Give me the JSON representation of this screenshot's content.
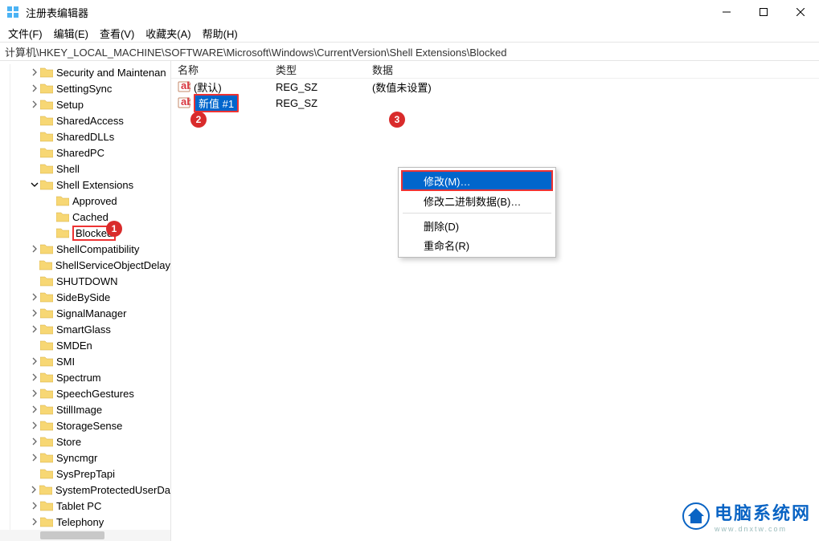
{
  "window": {
    "title": "注册表编辑器"
  },
  "menu": {
    "file": "文件(F)",
    "edit": "编辑(E)",
    "view": "查看(V)",
    "favorites": "收藏夹(A)",
    "help": "帮助(H)"
  },
  "address": "计算机\\HKEY_LOCAL_MACHINE\\SOFTWARE\\Microsoft\\Windows\\CurrentVersion\\Shell Extensions\\Blocked",
  "tree": {
    "items": [
      {
        "label": "Security and Maintenan",
        "level": 2,
        "expander": "right"
      },
      {
        "label": "SettingSync",
        "level": 2,
        "expander": "right"
      },
      {
        "label": "Setup",
        "level": 2,
        "expander": "right"
      },
      {
        "label": "SharedAccess",
        "level": 2,
        "expander": "none"
      },
      {
        "label": "SharedDLLs",
        "level": 2,
        "expander": "none"
      },
      {
        "label": "SharedPC",
        "level": 2,
        "expander": "none"
      },
      {
        "label": "Shell",
        "level": 2,
        "expander": "none"
      },
      {
        "label": "Shell Extensions",
        "level": 2,
        "expander": "down"
      },
      {
        "label": "Approved",
        "level": 3,
        "expander": "none"
      },
      {
        "label": "Cached",
        "level": 3,
        "expander": "none"
      },
      {
        "label": "Blocked",
        "level": 3,
        "expander": "none",
        "highlighted": true
      },
      {
        "label": "ShellCompatibility",
        "level": 2,
        "expander": "right"
      },
      {
        "label": "ShellServiceObjectDelay",
        "level": 2,
        "expander": "none"
      },
      {
        "label": "SHUTDOWN",
        "level": 2,
        "expander": "none"
      },
      {
        "label": "SideBySide",
        "level": 2,
        "expander": "right"
      },
      {
        "label": "SignalManager",
        "level": 2,
        "expander": "right"
      },
      {
        "label": "SmartGlass",
        "level": 2,
        "expander": "right"
      },
      {
        "label": "SMDEn",
        "level": 2,
        "expander": "none"
      },
      {
        "label": "SMI",
        "level": 2,
        "expander": "right"
      },
      {
        "label": "Spectrum",
        "level": 2,
        "expander": "right"
      },
      {
        "label": "SpeechGestures",
        "level": 2,
        "expander": "right"
      },
      {
        "label": "StillImage",
        "level": 2,
        "expander": "right"
      },
      {
        "label": "StorageSense",
        "level": 2,
        "expander": "right"
      },
      {
        "label": "Store",
        "level": 2,
        "expander": "right"
      },
      {
        "label": "Syncmgr",
        "level": 2,
        "expander": "right"
      },
      {
        "label": "SysPrepTapi",
        "level": 2,
        "expander": "none"
      },
      {
        "label": "SystemProtectedUserDa",
        "level": 2,
        "expander": "right"
      },
      {
        "label": "Tablet PC",
        "level": 2,
        "expander": "right"
      },
      {
        "label": "Telephony",
        "level": 2,
        "expander": "right"
      }
    ]
  },
  "list": {
    "columns": {
      "name": "名称",
      "type": "类型",
      "data": "数据"
    },
    "rows": [
      {
        "name": "(默认)",
        "type": "REG_SZ",
        "data": "(数值未设置)"
      },
      {
        "name": "新值 #1",
        "type": "REG_SZ",
        "data": "",
        "selected": true
      }
    ]
  },
  "contextMenu": {
    "modify": "修改(M)…",
    "modifyBinary": "修改二进制数据(B)…",
    "delete": "删除(D)",
    "rename": "重命名(R)"
  },
  "annotations": {
    "a1": "1",
    "a2": "2",
    "a3": "3"
  },
  "watermark": {
    "title": "电脑系统网",
    "sub": "www.dnxtw.com"
  }
}
